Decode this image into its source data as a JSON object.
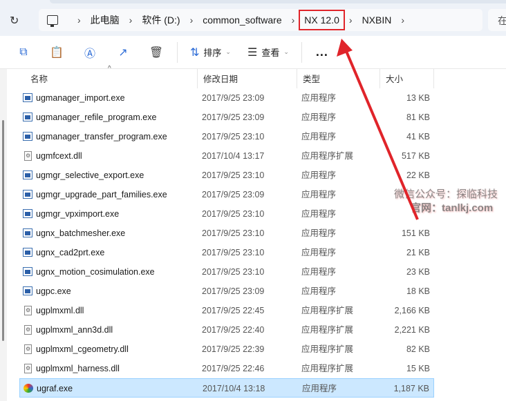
{
  "breadcrumb": [
    "此电脑",
    "软件 (D:)",
    "common_software",
    "NX 12.0",
    "NXBIN"
  ],
  "search_placeholder": "在",
  "toolbar": {
    "sort": "排序",
    "view": "查看",
    "more": "..."
  },
  "columns": {
    "name": "名称",
    "date": "修改日期",
    "type": "类型",
    "size": "大小"
  },
  "files": [
    {
      "name": "ugmanager_import.exe",
      "date": "2017/9/25 23:09",
      "type": "应用程序",
      "size": "13 KB",
      "kind": "exe"
    },
    {
      "name": "ugmanager_refile_program.exe",
      "date": "2017/9/25 23:09",
      "type": "应用程序",
      "size": "81 KB",
      "kind": "exe"
    },
    {
      "name": "ugmanager_transfer_program.exe",
      "date": "2017/9/25 23:10",
      "type": "应用程序",
      "size": "41 KB",
      "kind": "exe"
    },
    {
      "name": "ugmfcext.dll",
      "date": "2017/10/4 13:17",
      "type": "应用程序扩展",
      "size": "517 KB",
      "kind": "dll"
    },
    {
      "name": "ugmgr_selective_export.exe",
      "date": "2017/9/25 23:10",
      "type": "应用程序",
      "size": "22 KB",
      "kind": "exe"
    },
    {
      "name": "ugmgr_upgrade_part_families.exe",
      "date": "2017/9/25 23:09",
      "type": "应用程序",
      "size": "",
      "kind": "exe"
    },
    {
      "name": "ugmgr_vpximport.exe",
      "date": "2017/9/25 23:10",
      "type": "应用程序",
      "size": "",
      "kind": "exe"
    },
    {
      "name": "ugnx_batchmesher.exe",
      "date": "2017/9/25 23:10",
      "type": "应用程序",
      "size": "151 KB",
      "kind": "exe"
    },
    {
      "name": "ugnx_cad2prt.exe",
      "date": "2017/9/25 23:10",
      "type": "应用程序",
      "size": "21 KB",
      "kind": "exe"
    },
    {
      "name": "ugnx_motion_cosimulation.exe",
      "date": "2017/9/25 23:10",
      "type": "应用程序",
      "size": "23 KB",
      "kind": "exe"
    },
    {
      "name": "ugpc.exe",
      "date": "2017/9/25 23:09",
      "type": "应用程序",
      "size": "18 KB",
      "kind": "exe"
    },
    {
      "name": "ugplmxml.dll",
      "date": "2017/9/25 22:45",
      "type": "应用程序扩展",
      "size": "2,166 KB",
      "kind": "dll"
    },
    {
      "name": "ugplmxml_ann3d.dll",
      "date": "2017/9/25 22:40",
      "type": "应用程序扩展",
      "size": "2,221 KB",
      "kind": "dll"
    },
    {
      "name": "ugplmxml_cgeometry.dll",
      "date": "2017/9/25 22:39",
      "type": "应用程序扩展",
      "size": "82 KB",
      "kind": "dll"
    },
    {
      "name": "ugplmxml_harness.dll",
      "date": "2017/9/25 22:46",
      "type": "应用程序扩展",
      "size": "15 KB",
      "kind": "dll"
    },
    {
      "name": "ugraf.exe",
      "date": "2017/10/4 13:18",
      "type": "应用程序",
      "size": "1,187 KB",
      "kind": "app",
      "selected": true
    }
  ],
  "watermark": [
    "微信公众号：探临科技",
    "官网：tanlkj.com"
  ],
  "colors": {
    "highlight": "#e0242a",
    "selection": "#cce8ff"
  }
}
